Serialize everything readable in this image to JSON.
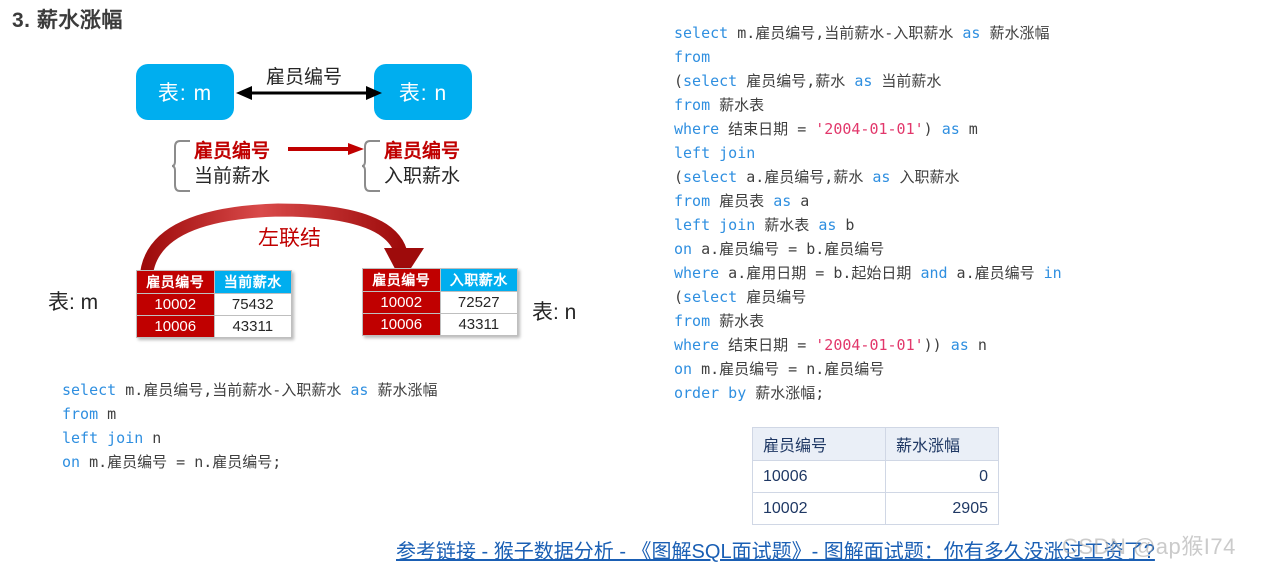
{
  "title": "3. 薪水涨幅",
  "diagram": {
    "box_m": "表: m",
    "box_n": "表: n",
    "link_label": "雇员编号",
    "left_fields": {
      "key": "雇员编号",
      "value": "当前薪水"
    },
    "right_fields": {
      "key": "雇员编号",
      "value": "入职薪水"
    },
    "curve_label": "左联结",
    "caption_m": "表: m",
    "caption_n": "表: n",
    "colors": {
      "box": "#00AEEF",
      "key_red": "#C00000",
      "link_blue": "#1a5fb4"
    }
  },
  "table_m": {
    "headers": [
      "雇员编号",
      "当前薪水"
    ],
    "rows": [
      [
        "10002",
        "75432"
      ],
      [
        "10006",
        "43311"
      ]
    ]
  },
  "table_n": {
    "headers": [
      "雇员编号",
      "入职薪水"
    ],
    "rows": [
      [
        "10002",
        "72527"
      ],
      [
        "10006",
        "43311"
      ]
    ]
  },
  "code_left": {
    "lines": [
      [
        {
          "t": "select",
          "c": "kw"
        },
        {
          "t": " m.雇员编号,当前薪水-入职薪水 ",
          "c": "pl"
        },
        {
          "t": "as",
          "c": "kw"
        },
        {
          "t": " 薪水涨幅",
          "c": "pl"
        }
      ],
      [
        {
          "t": "from",
          "c": "kw"
        },
        {
          "t": " m",
          "c": "pl"
        }
      ],
      [
        {
          "t": "left join",
          "c": "kw"
        },
        {
          "t": " n",
          "c": "pl"
        }
      ],
      [
        {
          "t": "on",
          "c": "kw"
        },
        {
          "t": " m.雇员编号 = n.雇员编号;",
          "c": "pl"
        }
      ]
    ]
  },
  "code_right": {
    "lines": [
      [
        {
          "t": "select",
          "c": "kw"
        },
        {
          "t": " m.雇员编号,当前薪水-入职薪水 ",
          "c": "pl"
        },
        {
          "t": "as",
          "c": "kw"
        },
        {
          "t": " 薪水涨幅",
          "c": "pl"
        }
      ],
      [
        {
          "t": "from",
          "c": "kw"
        }
      ],
      [
        {
          "t": "(",
          "c": "pl"
        },
        {
          "t": "select",
          "c": "kw"
        },
        {
          "t": " 雇员编号,薪水 ",
          "c": "pl"
        },
        {
          "t": "as",
          "c": "kw"
        },
        {
          "t": " 当前薪水",
          "c": "pl"
        }
      ],
      [
        {
          "t": "from",
          "c": "kw"
        },
        {
          "t": " 薪水表",
          "c": "pl"
        }
      ],
      [
        {
          "t": "where",
          "c": "kw"
        },
        {
          "t": " 结束日期 = ",
          "c": "pl"
        },
        {
          "t": "'2004-01-01'",
          "c": "str"
        },
        {
          "t": ") ",
          "c": "pl"
        },
        {
          "t": "as",
          "c": "kw"
        },
        {
          "t": " m",
          "c": "pl"
        }
      ],
      [
        {
          "t": "left join",
          "c": "kw"
        }
      ],
      [
        {
          "t": "(",
          "c": "pl"
        },
        {
          "t": "select",
          "c": "kw"
        },
        {
          "t": " a.雇员编号,薪水 ",
          "c": "pl"
        },
        {
          "t": "as",
          "c": "kw"
        },
        {
          "t": " 入职薪水",
          "c": "pl"
        }
      ],
      [
        {
          "t": "from",
          "c": "kw"
        },
        {
          "t": " 雇员表 ",
          "c": "pl"
        },
        {
          "t": "as",
          "c": "kw"
        },
        {
          "t": " a",
          "c": "pl"
        }
      ],
      [
        {
          "t": "left join",
          "c": "kw"
        },
        {
          "t": " 薪水表 ",
          "c": "pl"
        },
        {
          "t": "as",
          "c": "kw"
        },
        {
          "t": " b",
          "c": "pl"
        }
      ],
      [
        {
          "t": "on",
          "c": "kw"
        },
        {
          "t": " a.雇员编号 = b.雇员编号",
          "c": "pl"
        }
      ],
      [
        {
          "t": "where",
          "c": "kw"
        },
        {
          "t": " a.雇用日期 = b.起始日期 ",
          "c": "pl"
        },
        {
          "t": "and",
          "c": "kw"
        },
        {
          "t": " a.雇员编号 ",
          "c": "pl"
        },
        {
          "t": "in",
          "c": "kw"
        }
      ],
      [
        {
          "t": "(",
          "c": "pl"
        },
        {
          "t": "select",
          "c": "kw"
        },
        {
          "t": " 雇员编号",
          "c": "pl"
        }
      ],
      [
        {
          "t": "from",
          "c": "kw"
        },
        {
          "t": " 薪水表",
          "c": "pl"
        }
      ],
      [
        {
          "t": "where",
          "c": "kw"
        },
        {
          "t": " 结束日期 = ",
          "c": "pl"
        },
        {
          "t": "'2004-01-01'",
          "c": "str"
        },
        {
          "t": ")) ",
          "c": "pl"
        },
        {
          "t": "as",
          "c": "kw"
        },
        {
          "t": " n",
          "c": "pl"
        }
      ],
      [
        {
          "t": "on",
          "c": "kw"
        },
        {
          "t": " m.雇员编号 = n.雇员编号",
          "c": "pl"
        }
      ],
      [
        {
          "t": "order by",
          "c": "kw"
        },
        {
          "t": " 薪水涨幅;",
          "c": "pl"
        }
      ]
    ]
  },
  "result_table": {
    "headers": [
      "雇员编号",
      "薪水涨幅"
    ],
    "rows": [
      [
        "10006",
        "0"
      ],
      [
        "10002",
        "2905"
      ]
    ]
  },
  "footer": {
    "link_text": "参考链接 - 猴子数据分析 - 《图解SQL面试题》- 图解面试题：你有多久没涨过工资了?",
    "watermark": "CSDN @ap猴I74"
  }
}
